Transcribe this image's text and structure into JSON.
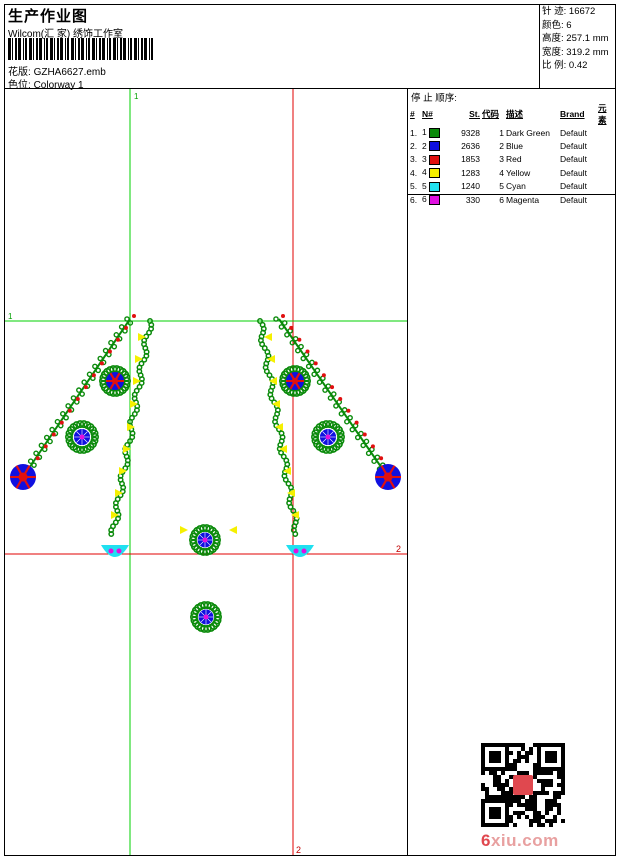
{
  "header": {
    "title": "生产作业图",
    "company": "Wilcom(汇 家) 绣饰工作室",
    "design_label": "花版:",
    "design_value": "GZHA6627.emb",
    "colorway_label": "色位:",
    "colorway_value": "Colorway 1"
  },
  "stats": [
    {
      "label": "针 迹:",
      "value": "16672"
    },
    {
      "label": "颜色:",
      "value": "6"
    },
    {
      "label": "高度:",
      "value": "257.1 mm"
    },
    {
      "label": "宽度:",
      "value": "319.2 mm"
    },
    {
      "label": "比 例:",
      "value": "0.42"
    }
  ],
  "stop_sequence": {
    "title": "停 止 顺序:",
    "headers": [
      "#",
      "N#",
      "St.",
      "代码",
      "描述",
      "Brand",
      "元素"
    ],
    "rows": [
      {
        "idx": "1.",
        "n": "1",
        "color": "#0a8a0a",
        "st": "9328",
        "code": "1",
        "desc": "Dark Green",
        "brand": "Default"
      },
      {
        "idx": "2.",
        "n": "2",
        "color": "#1010e0",
        "st": "2636",
        "code": "2",
        "desc": "Blue",
        "brand": "Default"
      },
      {
        "idx": "3.",
        "n": "3",
        "color": "#e01010",
        "st": "1853",
        "code": "3",
        "desc": "Red",
        "brand": "Default"
      },
      {
        "idx": "4.",
        "n": "4",
        "color": "#f5f000",
        "st": "1283",
        "code": "4",
        "desc": "Yellow",
        "brand": "Default"
      },
      {
        "idx": "5.",
        "n": "5",
        "color": "#20e0f0",
        "st": "1240",
        "code": "5",
        "desc": "Cyan",
        "brand": "Default"
      },
      {
        "idx": "6.",
        "n": "6",
        "color": "#e010e0",
        "st": "330",
        "code": "6",
        "desc": "Magenta",
        "brand": "Default"
      }
    ]
  },
  "guides": {
    "v1": "1",
    "h1": "1",
    "h2": "2",
    "v2": "2"
  },
  "watermark": {
    "prefix": "6",
    "rest": "xiu.com"
  },
  "colors": {
    "green": "#0a8a0a",
    "blue": "#1010e0",
    "red": "#e01010",
    "yellow": "#f5f000",
    "cyan": "#20e0f0",
    "magenta": "#e010e0",
    "guide_green": "#00d000",
    "guide_red": "#e00000"
  }
}
